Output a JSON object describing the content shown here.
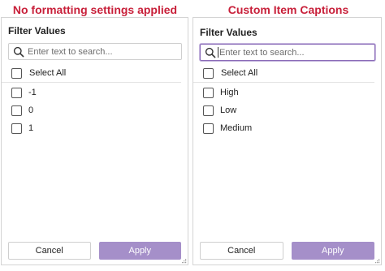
{
  "captions": {
    "left": "No formatting settings applied",
    "right": "Custom Item Captions"
  },
  "colors": {
    "caption": "#c8203a",
    "accent": "#a58fc9",
    "focus_border": "#8a6bb8"
  },
  "panels": [
    {
      "title": "Filter Values",
      "search": {
        "placeholder": "Enter text to search...",
        "value": ""
      },
      "select_all_label": "Select All",
      "items": [
        "-1",
        "0",
        "1"
      ],
      "cancel_label": "Cancel",
      "apply_label": "Apply"
    },
    {
      "title": "Filter Values",
      "search": {
        "placeholder": "Enter text to search...",
        "value": ""
      },
      "select_all_label": "Select All",
      "items": [
        "High",
        "Low",
        "Medium"
      ],
      "cancel_label": "Cancel",
      "apply_label": "Apply"
    }
  ],
  "icons": {
    "search": "search-icon",
    "resize": "resize-grip-icon"
  }
}
